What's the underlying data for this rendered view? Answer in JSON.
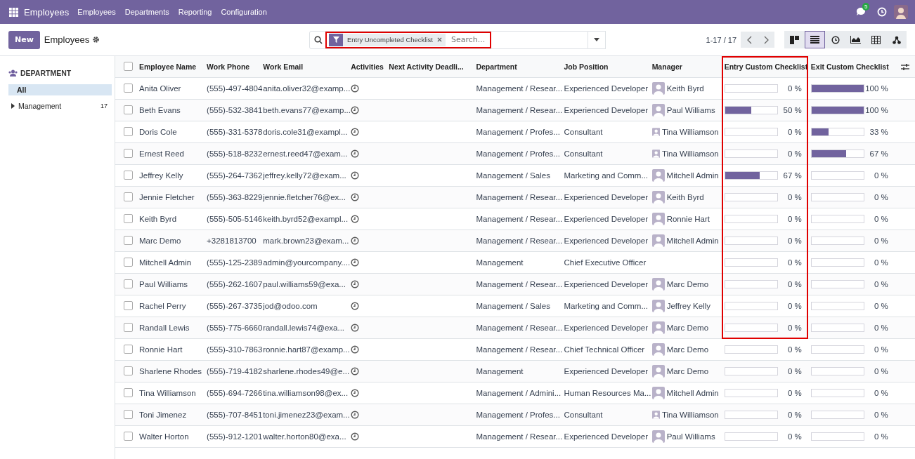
{
  "navbar": {
    "app_name": "Employees",
    "menu": [
      "Employees",
      "Departments",
      "Reporting",
      "Configuration"
    ],
    "chat_badge": "5"
  },
  "control_panel": {
    "new_button": "New",
    "breadcrumb": "Employees",
    "search": {
      "highlighted": true,
      "facet": "Entry Uncompleted Checklist",
      "placeholder": "Search..."
    },
    "pager": "1-17 / 17",
    "views": [
      {
        "kind": "kanban",
        "selected": false
      },
      {
        "kind": "list",
        "selected": true
      },
      {
        "kind": "activity",
        "selected": false
      },
      {
        "kind": "graph",
        "selected": false
      },
      {
        "kind": "pivot",
        "selected": false
      },
      {
        "kind": "hierarchy",
        "selected": false
      }
    ]
  },
  "sidebar": {
    "heading": "DEPARTMENT",
    "items": [
      {
        "label": "All",
        "selected": true
      },
      {
        "label": "Management",
        "count": "17",
        "selected": false
      }
    ]
  },
  "table": {
    "select_all_checked": false,
    "columns": [
      {
        "label": "Employee Name"
      },
      {
        "label": "Work Phone"
      },
      {
        "label": "Work Email"
      },
      {
        "label": "Activities"
      },
      {
        "label": "Next Activity Deadli..."
      },
      {
        "label": "Department"
      },
      {
        "label": "Job Position"
      },
      {
        "label": "Manager"
      },
      {
        "label": "Entry Custom Checklist",
        "highlighted": true
      },
      {
        "label": "Exit Custom Checklist"
      }
    ],
    "rows": [
      {
        "checked": false,
        "name": "Anita Oliver",
        "phone": "(555)-497-4804",
        "email": "anita.oliver32@examp...",
        "department": "Management / Resear...",
        "job": "Experienced Developer",
        "manager": "Keith Byrd",
        "entry": {
          "level": 0,
          "reading": "0 %",
          "highlighted": true
        },
        "exit": {
          "level": 1,
          "reading": "100 %"
        }
      },
      {
        "checked": false,
        "name": "Beth Evans",
        "phone": "(555)-532-3841",
        "email": "beth.evans77@examp...",
        "department": "Management / Resear...",
        "job": "Experienced Developer",
        "manager": "Paul Williams",
        "entry": {
          "level": 0.5,
          "reading": "50 %",
          "highlighted": true
        },
        "exit": {
          "level": 1,
          "reading": "100 %"
        }
      },
      {
        "checked": false,
        "name": "Doris Cole",
        "phone": "(555)-331-5378",
        "email": "doris.cole31@exampl...",
        "department": "Management / Profes...",
        "job": "Consultant",
        "manager": "Tina Williamson",
        "entry": {
          "level": 0,
          "reading": "0 %",
          "highlighted": true
        },
        "exit": {
          "level": 0.33,
          "reading": "33 %"
        }
      },
      {
        "checked": false,
        "name": "Ernest Reed",
        "phone": "(555)-518-8232",
        "email": "ernest.reed47@exam...",
        "department": "Management / Profes...",
        "job": "Consultant",
        "manager": "Tina Williamson",
        "entry": {
          "level": 0,
          "reading": "0 %",
          "highlighted": true
        },
        "exit": {
          "level": 0.67,
          "reading": "67 %"
        }
      },
      {
        "checked": false,
        "name": "Jeffrey Kelly",
        "phone": "(555)-264-7362",
        "email": "jeffrey.kelly72@exam...",
        "department": "Management / Sales",
        "job": "Marketing and Comm...",
        "manager": "Mitchell Admin",
        "entry": {
          "level": 0.67,
          "reading": "67 %",
          "highlighted": true
        },
        "exit": {
          "level": 0,
          "reading": "0 %"
        }
      },
      {
        "checked": false,
        "name": "Jennie Fletcher",
        "phone": "(555)-363-8229",
        "email": "jennie.fletcher76@ex...",
        "department": "Management / Resear...",
        "job": "Experienced Developer",
        "manager": "Keith Byrd",
        "entry": {
          "level": 0,
          "reading": "0 %",
          "highlighted": true
        },
        "exit": {
          "level": 0,
          "reading": "0 %"
        }
      },
      {
        "checked": false,
        "name": "Keith Byrd",
        "phone": "(555)-505-5146",
        "email": "keith.byrd52@exampl...",
        "department": "Management / Resear...",
        "job": "Experienced Developer",
        "manager": "Ronnie Hart",
        "entry": {
          "level": 0,
          "reading": "0 %",
          "highlighted": true
        },
        "exit": {
          "level": 0,
          "reading": "0 %"
        }
      },
      {
        "checked": false,
        "name": "Marc Demo",
        "phone": "+3281813700",
        "email": "mark.brown23@exam...",
        "department": "Management / Resear...",
        "job": "Experienced Developer",
        "manager": "Mitchell Admin",
        "entry": {
          "level": 0,
          "reading": "0 %",
          "highlighted": true
        },
        "exit": {
          "level": 0,
          "reading": "0 %"
        }
      },
      {
        "checked": false,
        "name": "Mitchell Admin",
        "phone": "(555)-125-2389",
        "email": "admin@yourcompany....",
        "department": "Management",
        "job": "Chief Executive Officer",
        "entry": {
          "level": 0,
          "reading": "0 %",
          "highlighted": true
        },
        "exit": {
          "level": 0,
          "reading": "0 %"
        }
      },
      {
        "checked": false,
        "name": "Paul Williams",
        "phone": "(555)-262-1607",
        "email": "paul.williams59@exa...",
        "department": "Management / Resear...",
        "job": "Experienced Developer",
        "manager": "Marc Demo",
        "entry": {
          "level": 0,
          "reading": "0 %",
          "highlighted": true
        },
        "exit": {
          "level": 0,
          "reading": "0 %"
        }
      },
      {
        "checked": false,
        "name": "Rachel Perry",
        "phone": "(555)-267-3735",
        "email": "jod@odoo.com",
        "department": "Management / Sales",
        "job": "Marketing and Comm...",
        "manager": "Jeffrey Kelly",
        "entry": {
          "level": 0,
          "reading": "0 %",
          "highlighted": true
        },
        "exit": {
          "level": 0,
          "reading": "0 %"
        }
      },
      {
        "checked": false,
        "name": "Randall Lewis",
        "phone": "(555)-775-6660",
        "email": "randall.lewis74@exa...",
        "department": "Management / Resear...",
        "job": "Experienced Developer",
        "manager": "Marc Demo",
        "entry": {
          "level": 0,
          "reading": "0 %",
          "highlighted": true
        },
        "exit": {
          "level": 0,
          "reading": "0 %"
        }
      },
      {
        "checked": false,
        "name": "Ronnie Hart",
        "phone": "(555)-310-7863",
        "email": "ronnie.hart87@examp...",
        "department": "Management / Resear...",
        "job": "Chief Technical Officer",
        "manager": "Marc Demo",
        "entry": {
          "level": 0,
          "reading": "0 %",
          "highlighted": false
        },
        "exit": {
          "level": 0,
          "reading": "0 %"
        }
      },
      {
        "checked": false,
        "name": "Sharlene Rhodes",
        "phone": "(555)-719-4182",
        "email": "sharlene.rhodes49@e...",
        "department": "Management",
        "job": "Experienced Developer",
        "manager": "Marc Demo",
        "entry": {
          "level": 0,
          "reading": "0 %",
          "highlighted": false
        },
        "exit": {
          "level": 0,
          "reading": "0 %"
        }
      },
      {
        "checked": false,
        "name": "Tina Williamson",
        "phone": "(555)-694-7266",
        "email": "tina.williamson98@ex...",
        "department": "Management / Admini...",
        "job": "Human Resources Ma...",
        "manager": "Mitchell Admin",
        "entry": {
          "level": 0,
          "reading": "0 %",
          "highlighted": false
        },
        "exit": {
          "level": 0,
          "reading": "0 %"
        }
      },
      {
        "checked": false,
        "name": "Toni Jimenez",
        "phone": "(555)-707-8451",
        "email": "toni.jimenez23@exam...",
        "department": "Management / Profes...",
        "job": "Consultant",
        "manager": "Tina Williamson",
        "entry": {
          "level": 0,
          "reading": "0 %",
          "highlighted": false
        },
        "exit": {
          "level": 0,
          "reading": "0 %"
        }
      },
      {
        "checked": false,
        "name": "Walter Horton",
        "phone": "(555)-912-1201",
        "email": "walter.horton80@exa...",
        "department": "Management / Resear...",
        "job": "Experienced Developer",
        "manager": "Paul Williams",
        "entry": {
          "level": 0,
          "reading": "0 %",
          "highlighted": false
        },
        "exit": {
          "level": 0,
          "reading": "0 %"
        }
      }
    ]
  }
}
